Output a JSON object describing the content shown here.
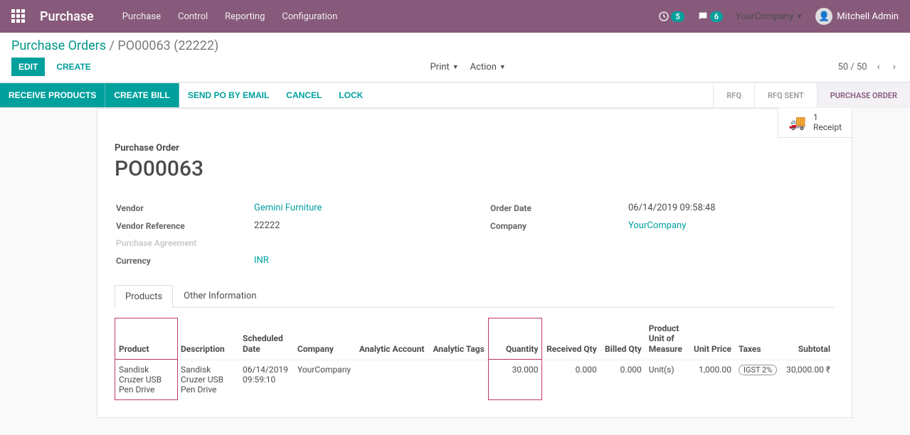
{
  "navbar": {
    "brand": "Purchase",
    "menu": [
      "Purchase",
      "Control",
      "Reporting",
      "Configuration"
    ],
    "activity_count": "5",
    "msg_count": "6",
    "company": "YourCompany",
    "user": "Mitchell Admin"
  },
  "breadcrumb": {
    "parent": "Purchase Orders",
    "current": "PO00063 (22222)"
  },
  "cp": {
    "edit": "EDIT",
    "create": "CREATE",
    "print": "Print",
    "action": "Action",
    "pager": "50 / 50"
  },
  "actions": {
    "receive": "RECEIVE PRODUCTS",
    "bill": "CREATE BILL",
    "send": "SEND PO BY EMAIL",
    "cancel": "CANCEL",
    "lock": "LOCK",
    "steps": [
      "RFQ",
      "RFQ SENT",
      "PURCHASE ORDER"
    ]
  },
  "statbox": {
    "count": "1",
    "label": "Receipt"
  },
  "title": {
    "label": "Purchase Order",
    "name": "PO00063"
  },
  "left_fields": {
    "vendor_label": "Vendor",
    "vendor": "Gemini Furniture",
    "ref_label": "Vendor Reference",
    "ref": "22222",
    "agreement_label": "Purchase Agreement",
    "currency_label": "Currency",
    "currency": "INR"
  },
  "right_fields": {
    "date_label": "Order Date",
    "date": "06/14/2019 09:58:48",
    "company_label": "Company",
    "company": "YourCompany"
  },
  "tabs": {
    "products": "Products",
    "other": "Other Information"
  },
  "table": {
    "headers": {
      "product": "Product",
      "description": "Description",
      "scheduled": "Scheduled Date",
      "company": "Company",
      "analytic_acc": "Analytic Account",
      "analytic_tags": "Analytic Tags",
      "quantity": "Quantity",
      "received": "Received Qty",
      "billed": "Billed Qty",
      "uom": "Product Unit of Measure",
      "unit_price": "Unit Price",
      "taxes": "Taxes",
      "subtotal": "Subtotal"
    },
    "rows": [
      {
        "product": "Sandisk Cruzer USB Pen Drive",
        "description": "Sandisk Cruzer USB Pen Drive",
        "scheduled": "06/14/2019 09:59:10",
        "company": "YourCompany",
        "analytic_acc": "",
        "analytic_tags": "",
        "quantity": "30.000",
        "received": "0.000",
        "billed": "0.000",
        "uom": "Unit(s)",
        "unit_price": "1,000.00",
        "taxes": "IGST 2%",
        "subtotal": "30,000.00 ₹"
      }
    ]
  }
}
